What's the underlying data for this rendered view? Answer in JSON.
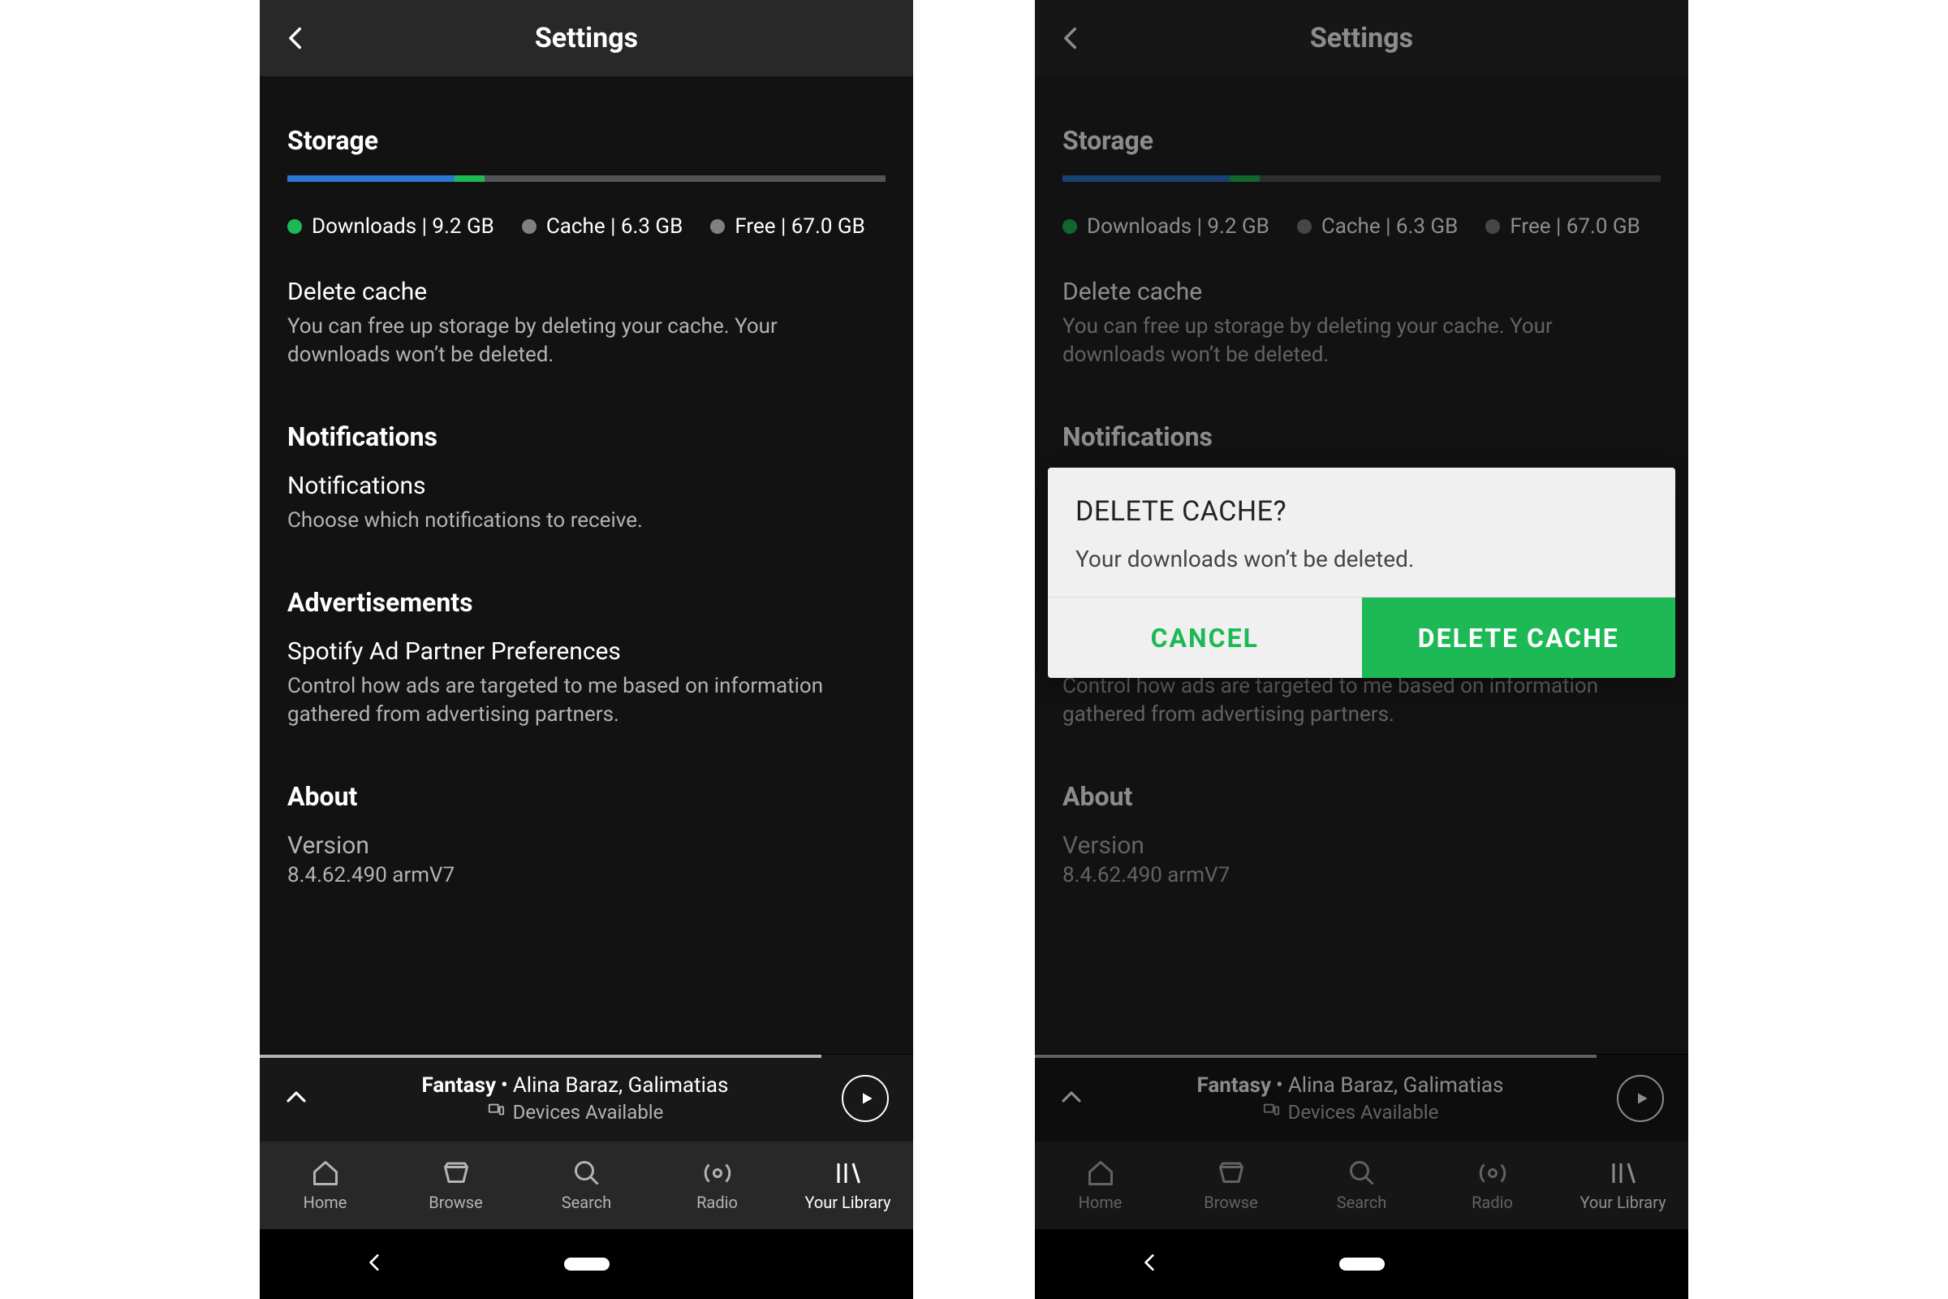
{
  "header": {
    "title": "Settings"
  },
  "storage": {
    "heading": "Storage",
    "bar": {
      "downloads_pct": 28,
      "cache_pct": 5
    },
    "legend": {
      "downloads": "Downloads | 9.2 GB",
      "cache": "Cache | 6.3 GB",
      "free": "Free | 67.0 GB"
    },
    "delete_cache": {
      "title": "Delete cache",
      "desc": "You can free up storage by deleting your cache. Your downloads won’t be deleted."
    }
  },
  "notifications": {
    "heading": "Notifications",
    "item": {
      "title": "Notifications",
      "desc": "Choose which notifications to receive."
    }
  },
  "ads": {
    "heading": "Advertisements",
    "item": {
      "title": "Spotify Ad Partner Preferences",
      "desc": "Control how ads are targeted to me based on information gathered from advertising partners."
    }
  },
  "about": {
    "heading": "About",
    "version_label": "Version",
    "version_value": "8.4.62.490 armV7"
  },
  "nowplaying": {
    "progress_pct": 86,
    "song": "Fantasy",
    "artist": "Alina Baraz, Galimatias",
    "devices": "Devices Available"
  },
  "tabs": {
    "home": "Home",
    "browse": "Browse",
    "search": "Search",
    "radio": "Radio",
    "library": "Your Library"
  },
  "dialog": {
    "title": "DELETE CACHE?",
    "message": "Your downloads won’t be deleted.",
    "cancel": "CANCEL",
    "confirm": "DELETE CACHE"
  }
}
